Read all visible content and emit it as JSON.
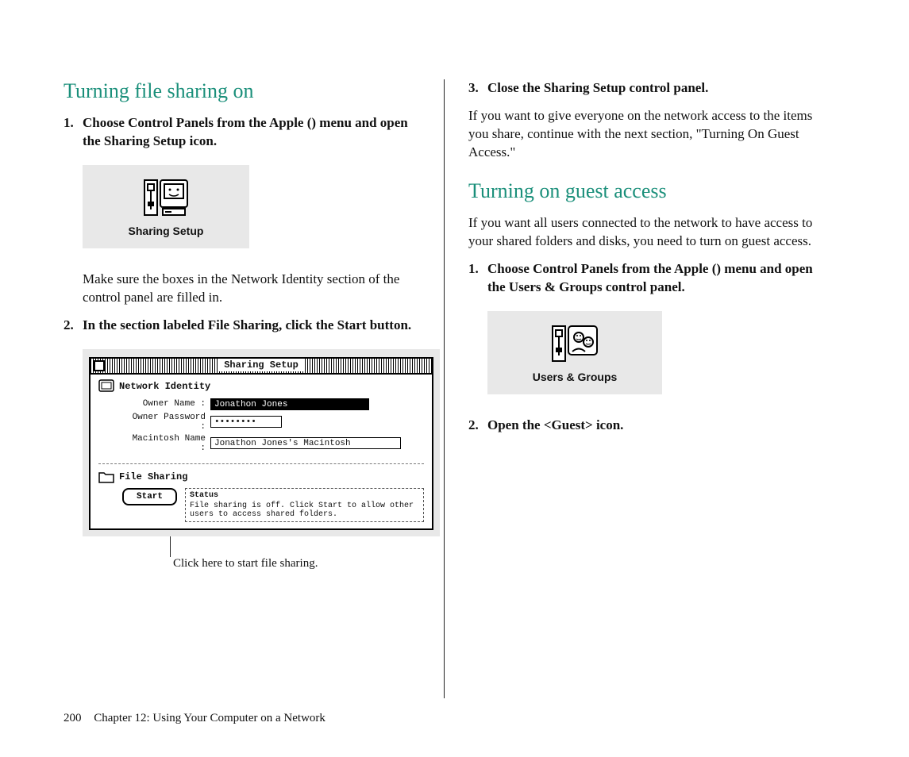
{
  "left": {
    "heading": "Turning file sharing on",
    "step1_num": "1.",
    "step1_pre": "Choose Control Panels from the Apple (",
    "step1_post": ") menu and open the Sharing Setup icon.",
    "icon_label": "Sharing Setup",
    "note": "Make sure the boxes in the Network Identity section of the control panel are filled in.",
    "step2_num": "2.",
    "step2": "In the section labeled File Sharing, click the Start button.",
    "window": {
      "title": "Sharing Setup",
      "net_identity": "Network Identity",
      "owner_name_lbl": "Owner Name :",
      "owner_name_val": "Jonathon Jones",
      "owner_pw_lbl": "Owner Password :",
      "owner_pw_val": "••••••••",
      "mac_name_lbl": "Macintosh Name :",
      "mac_name_val": "Jonathon Jones's Macintosh",
      "file_sharing": "File Sharing",
      "start_btn": "Start",
      "status_title": "Status",
      "status_msg": "File sharing is off. Click Start to allow other users to access shared folders."
    },
    "callout": "Click here to start file sharing."
  },
  "right": {
    "step3_num": "3.",
    "step3": "Close the Sharing Setup control panel.",
    "para1": "If you want to give everyone on the network access to the items you share, continue with the next section, \"Turning On Guest Access.\"",
    "heading2": "Turning on guest access",
    "para2": "If you want all users connected to the network to have access to your shared folders and disks, you need to turn on guest access.",
    "step1_num": "1.",
    "step1_pre": "Choose Control Panels from the Apple (",
    "step1_post": ") menu and open the Users & Groups control panel.",
    "icon_label": "Users & Groups",
    "step2_num": "2.",
    "step2": "Open the <Guest> icon."
  },
  "footer": {
    "page": "200",
    "chapter": "Chapter 12: Using Your Computer on a Network"
  }
}
